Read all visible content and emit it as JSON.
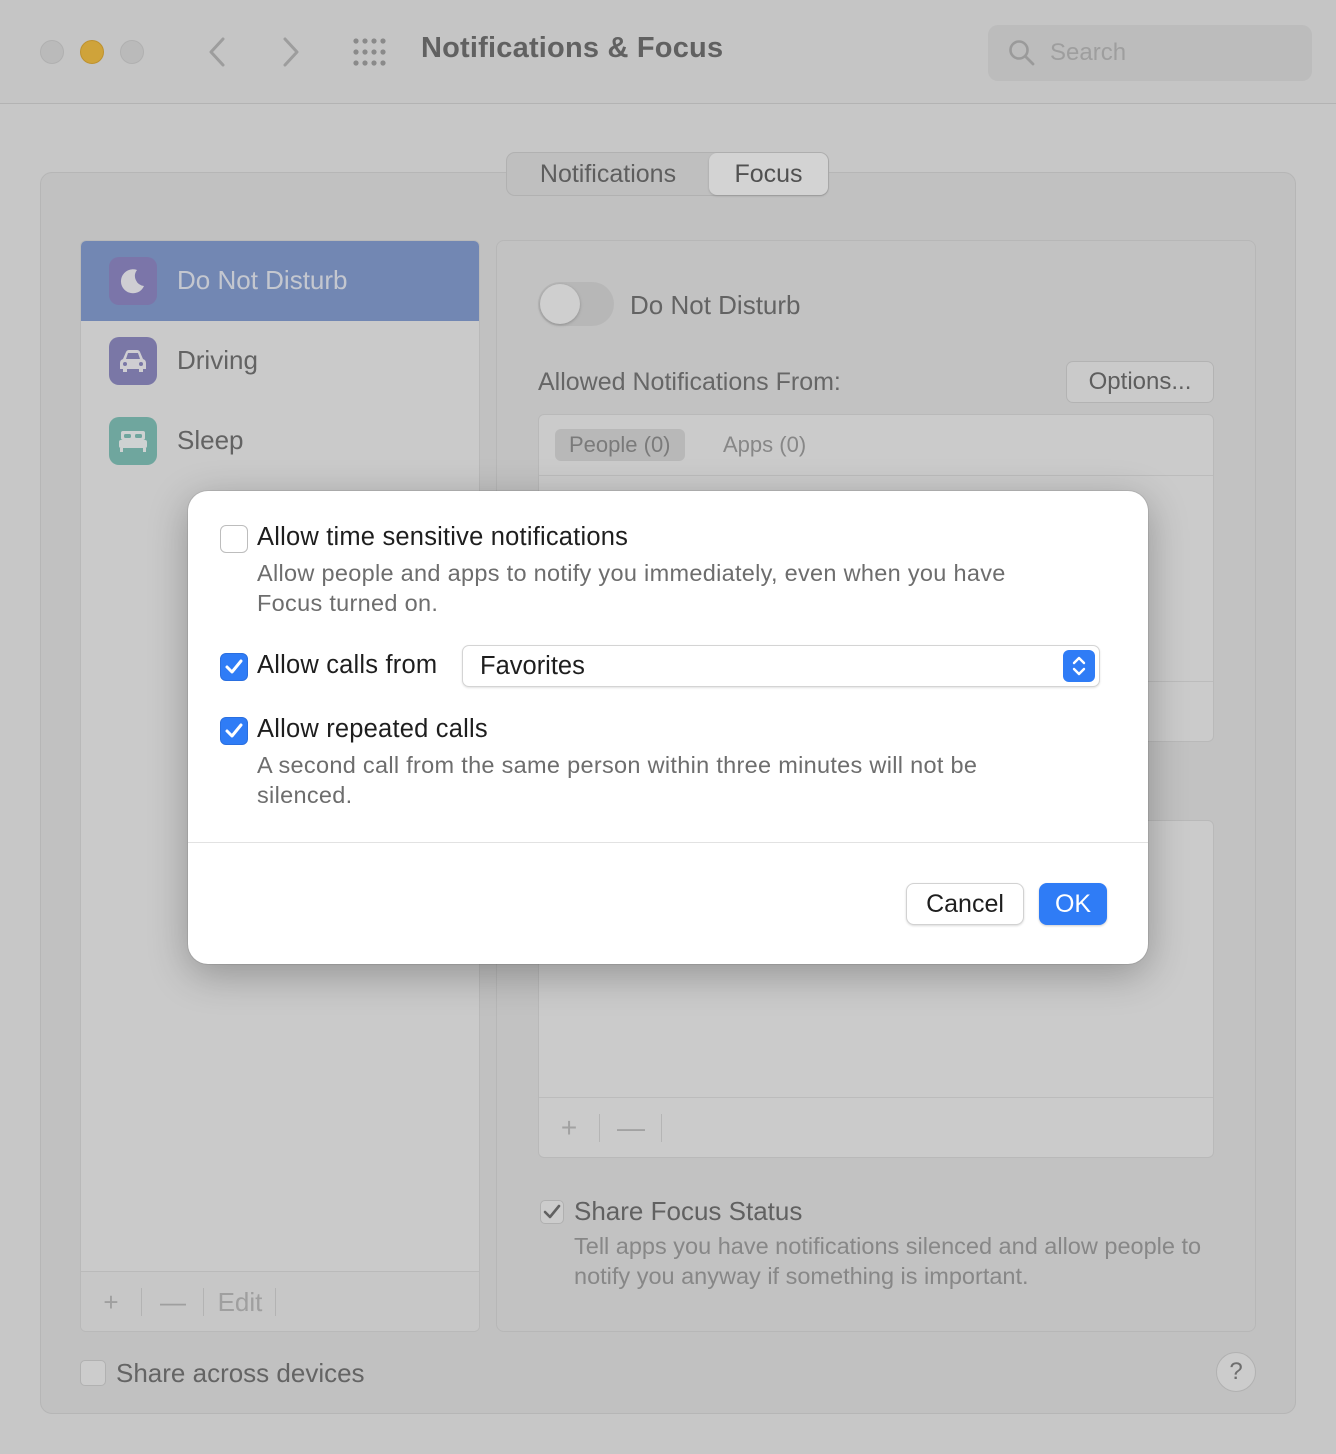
{
  "window": {
    "title": "Notifications & Focus",
    "search_placeholder": "Search"
  },
  "tabs": [
    {
      "label": "Notifications",
      "selected": false
    },
    {
      "label": "Focus",
      "selected": true
    }
  ],
  "sidebar": {
    "items": [
      {
        "label": "Do Not Disturb",
        "icon": "moon-icon",
        "icon_color": "#8b83c6",
        "selected": true
      },
      {
        "label": "Driving",
        "icon": "car-icon",
        "icon_color": "#8a86c2",
        "selected": false
      },
      {
        "label": "Sleep",
        "icon": "bed-icon",
        "icon_color": "#7cc2b8",
        "selected": false
      }
    ],
    "footer": {
      "add": "+",
      "remove": "—",
      "edit": "Edit"
    }
  },
  "detail": {
    "toggle_label": "Do Not Disturb",
    "toggle_on": false,
    "allowed_label": "Allowed Notifications From:",
    "options_button": "Options...",
    "people_tab": "People (0)",
    "apps_tab": "Apps (0)",
    "list_add": "+",
    "list_remove": "—",
    "share_status_label": "Share Focus Status",
    "share_status_checked": true,
    "share_status_desc": "Tell apps you have notifications silenced and allow people to notify you anyway if something is important.",
    "share_across_label": "Share across devices",
    "share_across_checked": false,
    "help": "?"
  },
  "dialog": {
    "time_sensitive": {
      "label": "Allow time sensitive notifications",
      "checked": false,
      "desc": "Allow people and apps to notify you immediately, even when you have Focus turned on."
    },
    "calls_from": {
      "label": "Allow calls from",
      "checked": true,
      "selected_value": "Favorites"
    },
    "repeated_calls": {
      "label": "Allow repeated calls",
      "checked": true,
      "desc": "A second call from the same person within three minutes will not be silenced."
    },
    "cancel_button": "Cancel",
    "ok_button": "OK"
  },
  "colors": {
    "accent": "#2f7cf6",
    "sidebar_selected": "#7f9ad2",
    "traffic_minimize": "#f6be38"
  }
}
